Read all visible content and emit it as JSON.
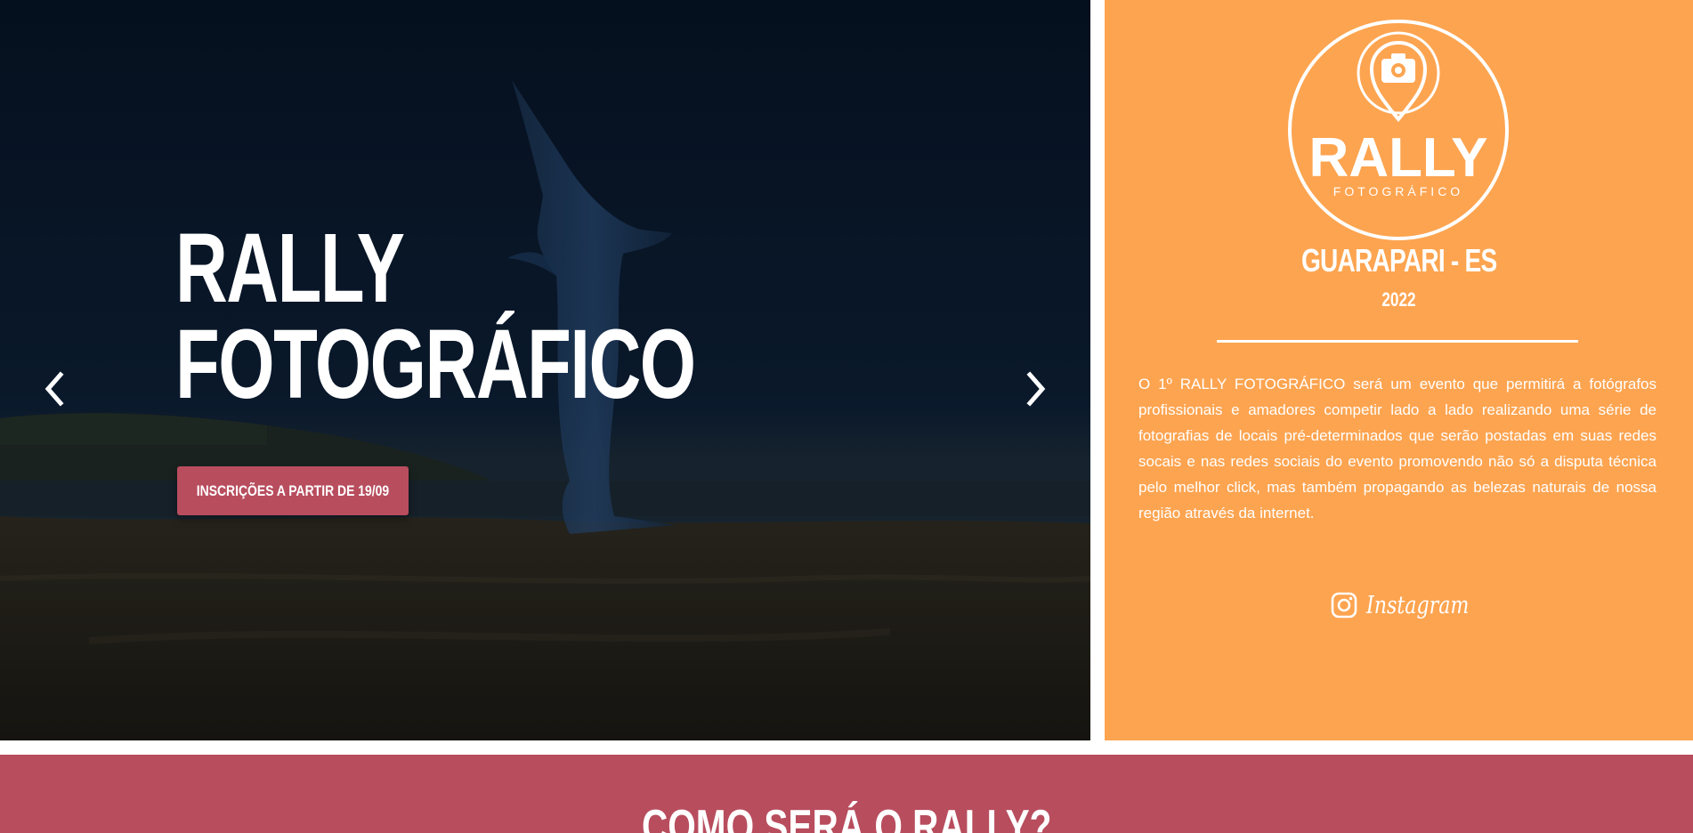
{
  "hero": {
    "title_line1": "RALLY",
    "title_line2": "FOTOGRÁFICO",
    "cta_label": "INSCRIÇÕES A PARTIR DE 19/09",
    "prev_icon": "chevron-left-icon",
    "next_icon": "chevron-right-icon"
  },
  "info": {
    "logo_title": "RALLY",
    "logo_subtitle": "FOTOGRÁFICO",
    "logo_icon": "camera-pin-icon",
    "location": "GUARAPARI - ES",
    "year": "2022",
    "description": "O 1º RALLY FOTOGRÁFICO será um evento que permitirá a fotógrafos profissionais e amadores competir lado a lado realizando uma série de fotografias de locais pré-determinados que serão postadas em suas redes socais e nas redes sociais do evento promovendo não só a disputa técnica pelo melhor click, mas também propagando as belezas naturais de nossa região através da internet.",
    "social_label": "Instagram",
    "social_icon": "instagram-icon"
  },
  "section2": {
    "title": "COMO SERÁ O RALLY?"
  },
  "colors": {
    "panel": "#fda450",
    "accent": "#b84d5e",
    "hero_bg": "#0c1d33",
    "text": "#ffffff"
  }
}
